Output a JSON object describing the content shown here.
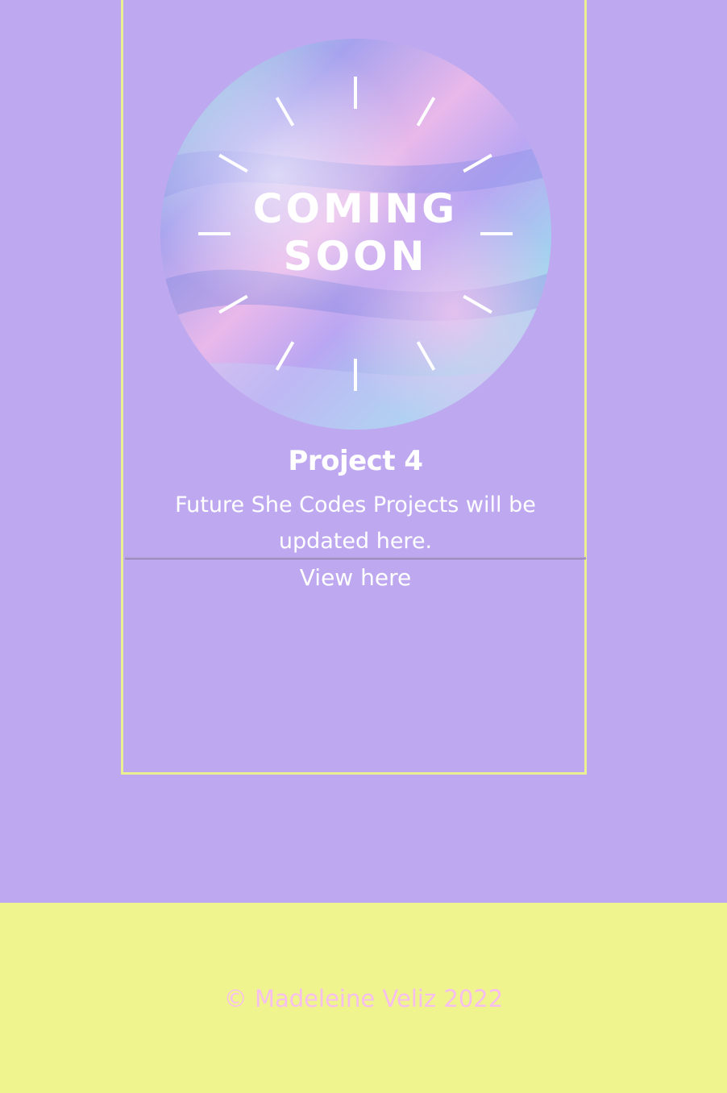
{
  "project": {
    "badge_line1": "COMING",
    "badge_line2": "SOON",
    "badge_icon": "coming-soon-burst-icon",
    "title": "Project 4",
    "description": "Future She Codes Projects will be updated here.",
    "link_label": "View here"
  },
  "footer": {
    "copyright": "© Madeleine Veliz 2022"
  },
  "colors": {
    "background": "#bea9f0",
    "card_border": "#ecef8f",
    "footer_bg": "#eff48f",
    "footer_text": "#f7bff0",
    "text": "#ffffff"
  }
}
